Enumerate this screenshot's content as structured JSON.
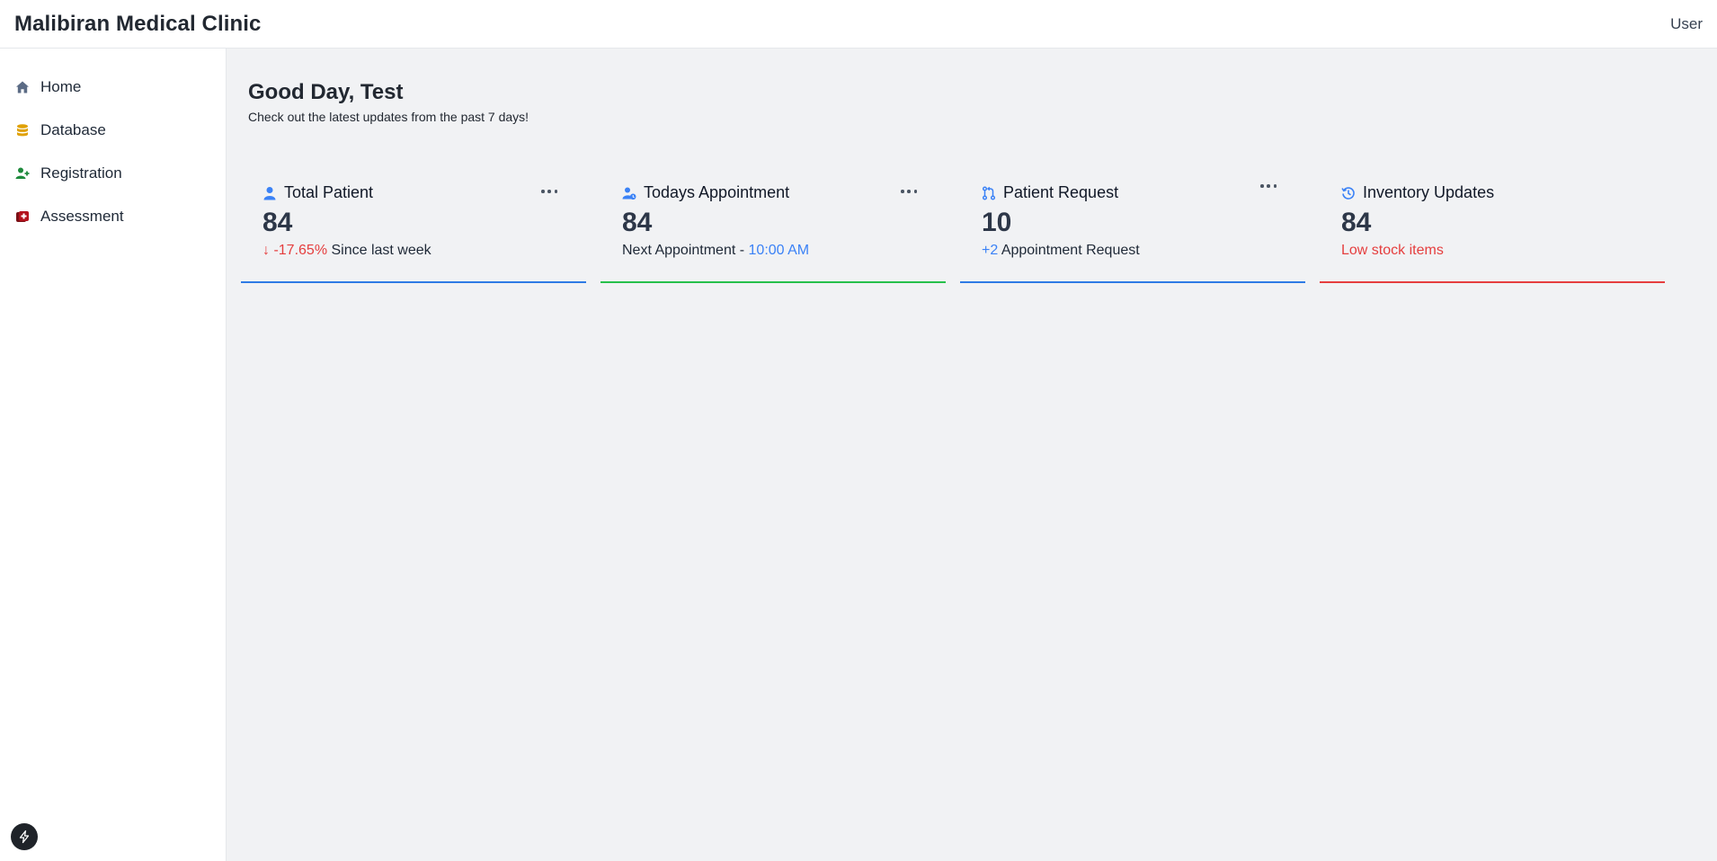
{
  "app": {
    "title": "Malibiran Medical Clinic",
    "user_label": "User"
  },
  "sidebar": {
    "items": [
      {
        "label": "Home",
        "icon": "home-icon",
        "color": "#5b6b85"
      },
      {
        "label": "Database",
        "icon": "database-icon",
        "color": "#e0a106"
      },
      {
        "label": "Registration",
        "icon": "user-plus-icon",
        "color": "#1e8a3c"
      },
      {
        "label": "Assessment",
        "icon": "medical-kit-icon",
        "color": "#b3131d"
      }
    ]
  },
  "greeting": {
    "title": "Good Day, Test",
    "subtitle": "Check out the latest updates from the past 7 days!"
  },
  "cards": [
    {
      "title": "Total Patient",
      "icon": "user-icon",
      "value": "84",
      "change": "↓ -17.65%",
      "change_suffix": " Since last week",
      "accent": "#2f7be5"
    },
    {
      "title": "Todays Appointment",
      "icon": "user-clock-icon",
      "value": "84",
      "sub_prefix": "Next Appointment - ",
      "sub_time": "10:00 AM",
      "accent": "#27c04b"
    },
    {
      "title": "Patient Request",
      "icon": "git-pull-request-icon",
      "value": "10",
      "delta": "+2",
      "sub_suffix": " Appointment Request",
      "accent": "#2f7be5"
    },
    {
      "title": "Inventory Updates",
      "icon": "history-icon",
      "value": "84",
      "alert": "Low stock items",
      "accent": "#e53e3e"
    }
  ]
}
